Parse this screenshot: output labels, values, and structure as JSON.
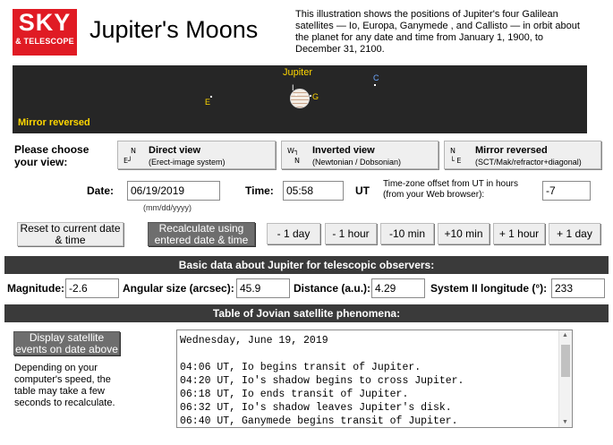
{
  "header": {
    "logo_top": "SKY",
    "logo_bottom": "& TELESCOPE",
    "title": "Jupiter's Moons",
    "description": "This illustration shows the positions of Jupiter's four Galilean satellites — Io, Europa, Ganymede , and Callisto — in orbit about the planet for any date and time from January 1, 1900, to December 31, 2100."
  },
  "sky": {
    "planet_label": "Jupiter",
    "mirror_label": "Mirror reversed",
    "moons": {
      "io": "I",
      "ganymede": "G",
      "europa": "E",
      "callisto": "C"
    },
    "colors": {
      "background": "#262626",
      "label": "#ffd700",
      "io": "#ffffff",
      "ganymede": "#ffd700",
      "europa": "#ffd700",
      "callisto": "#6fa8ff"
    }
  },
  "view": {
    "prompt": "Please choose your view:",
    "options": [
      {
        "compass_top": "N",
        "compass_bottom": "E┘",
        "title": "Direct view",
        "subtitle": "(Erect-image system)"
      },
      {
        "compass_top": "W┐",
        "compass_bottom": "N",
        "title": "Inverted view",
        "subtitle": "(Newtonian / Dobsonian)"
      },
      {
        "compass_top": "N",
        "compass_bottom": "└ E",
        "title": "Mirror reversed",
        "subtitle": "(SCT/Mak/refractor+diagonal)"
      }
    ]
  },
  "datetime": {
    "date_label": "Date:",
    "date_value": "06/19/2019",
    "date_hint": "(mm/dd/yyyy)",
    "time_label": "Time:",
    "time_value": "05:58",
    "ut_label": "UT",
    "tz_label": "Time-zone offset from UT in hours (from your Web browser):",
    "tz_value": "-7"
  },
  "buttons": {
    "reset": "Reset to current date & time",
    "recalc": "Recalculate using entered date & time",
    "minus_day": "- 1 day",
    "minus_hour": "- 1 hour",
    "minus_10min": "-10 min",
    "plus_10min": "+10 min",
    "plus_hour": "+ 1 hour",
    "plus_day": "+ 1 day"
  },
  "basic": {
    "header": "Basic data about Jupiter for telescopic observers:",
    "magnitude_label": "Magnitude:",
    "magnitude": "-2.6",
    "size_label": "Angular size (arcsec):",
    "size": "45.9",
    "distance_label": "Distance (a.u.):",
    "distance": "4.29",
    "longitude_label": "System II longitude (°):",
    "longitude": "233"
  },
  "phenomena": {
    "header": "Table of Jovian satellite phenomena:",
    "display_button": "Display satellite events on date above",
    "note": "Depending on your computer's speed, the table may take a few seconds to recalculate.",
    "lines": [
      "Wednesday, June 19, 2019",
      "",
      "04:06 UT, Io begins transit of Jupiter.",
      "04:20 UT, Io's shadow begins to cross Jupiter.",
      "06:18 UT, Io ends transit of Jupiter.",
      "06:32 UT, Io's shadow leaves Jupiter's disk.",
      "06:40 UT, Ganymede begins transit of Jupiter."
    ]
  }
}
